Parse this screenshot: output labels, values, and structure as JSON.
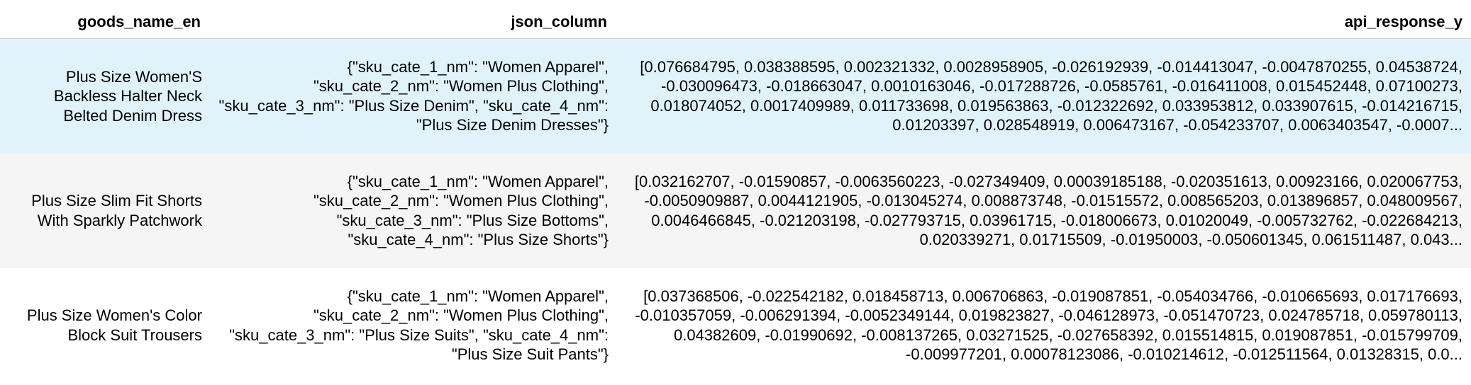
{
  "table": {
    "headers": [
      "goods_name_en",
      "json_column",
      "api_response_y"
    ],
    "rows": [
      {
        "goods_name_en": "Plus Size Women'S Backless Halter Neck Belted Denim Dress",
        "json_column": "{\"sku_cate_1_nm\": \"Women Apparel\", \"sku_cate_2_nm\": \"Women Plus Clothing\", \"sku_cate_3_nm\": \"Plus Size Denim\", \"sku_cate_4_nm\": \"Plus Size Denim Dresses\"}",
        "api_response_y": "[0.076684795, 0.038388595, 0.002321332, 0.0028958905, -0.026192939, -0.014413047, -0.0047870255, 0.04538724, -0.030096473, -0.018663047, 0.0010163046, -0.017288726, -0.0585761, -0.016411008, 0.015452448, 0.07100273, 0.018074052, 0.0017409989, 0.011733698, 0.019563863, -0.012322692, 0.033953812, 0.033907615, -0.014216715, 0.01203397, 0.028548919, 0.006473167, -0.054233707, 0.0063403547, -0.0007..."
      },
      {
        "goods_name_en": "Plus Size Slim Fit Shorts With Sparkly Patchwork",
        "json_column": "{\"sku_cate_1_nm\": \"Women Apparel\", \"sku_cate_2_nm\": \"Women Plus Clothing\", \"sku_cate_3_nm\": \"Plus Size Bottoms\", \"sku_cate_4_nm\": \"Plus Size Shorts\"}",
        "api_response_y": "[0.032162707, -0.01590857, -0.0063560223, -0.027349409, 0.00039185188, -0.020351613, 0.00923166, 0.020067753, -0.0050909887, 0.0044121905, -0.013045274, 0.008873748, -0.01515572, 0.008565203, 0.013896857, 0.048009567, 0.0046466845, -0.021203198, -0.027793715, 0.03961715, -0.018006673, 0.01020049, -0.005732762, -0.022684213, 0.020339271, 0.01715509, -0.01950003, -0.050601345, 0.061511487, 0.043..."
      },
      {
        "goods_name_en": "Plus Size Women's Color Block Suit Trousers",
        "json_column": "{\"sku_cate_1_nm\": \"Women Apparel\", \"sku_cate_2_nm\": \"Women Plus Clothing\", \"sku_cate_3_nm\": \"Plus Size Suits\", \"sku_cate_4_nm\": \"Plus Size Suit Pants\"}",
        "api_response_y": "[0.037368506, -0.022542182, 0.018458713, 0.006706863, -0.019087851, -0.054034766, -0.010665693, 0.017176693, -0.010357059, -0.006291394, -0.0052349144, 0.019823827, -0.046128973, -0.051470723, 0.024785718, 0.059780113, 0.04382609, -0.01990692, -0.008137265, 0.03271525, -0.027658392, 0.015514815, 0.019087851, -0.015799709, -0.009977201, 0.00078123086, -0.010214612, -0.012511564, 0.01328315, 0.0..."
      }
    ]
  }
}
